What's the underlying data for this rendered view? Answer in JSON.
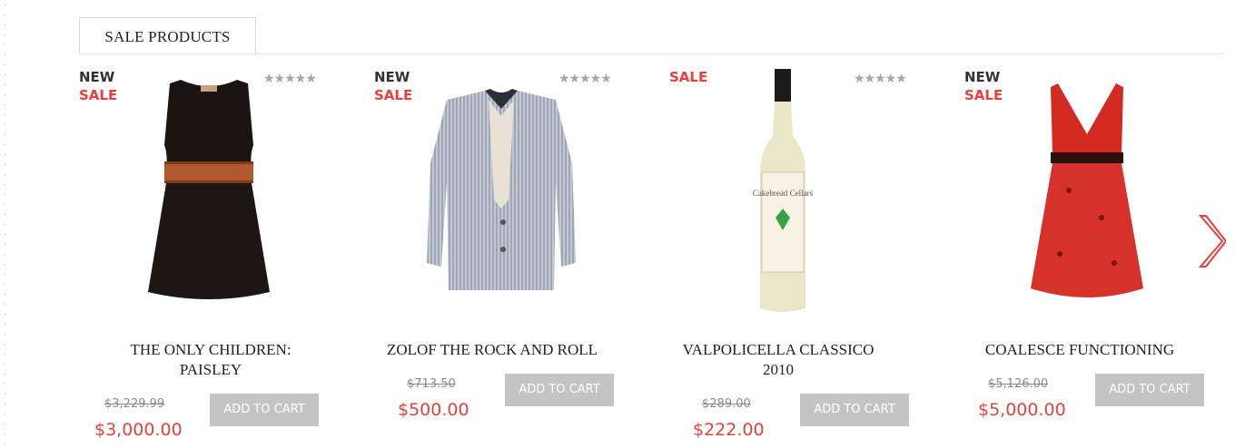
{
  "section": {
    "tab_label": "SALE PRODUCTS"
  },
  "products": [
    {
      "name": "THE ONLY CHILDREN: PAISLEY",
      "badge_new": "NEW",
      "badge_sale": "SALE",
      "old_price": "$3,229.99",
      "price": "$3,000.00",
      "cart_label": "ADD TO CART",
      "stars": "★★★★★",
      "image": "black-dress-image"
    },
    {
      "name": "ZOLOF THE ROCK AND ROLL",
      "badge_new": "NEW",
      "badge_sale": "SALE",
      "old_price": "$713.50",
      "price": "$500.00",
      "cart_label": "ADD TO CART",
      "stars": "★★★★★",
      "image": "striped-blazer-image"
    },
    {
      "name": "VALPOLICELLA CLASSICO 2010",
      "badge_sale": "SALE",
      "old_price": "$289.00",
      "price": "$222.00",
      "cart_label": "ADD TO CART",
      "stars": "★★★★★",
      "image": "wine-bottle-image",
      "bottle_label": "Cakebread Cellars"
    },
    {
      "name": "COALESCE FUNCTIONING",
      "badge_new": "NEW",
      "badge_sale": "SALE",
      "old_price": "$5,126.00",
      "price": "$5,000.00",
      "cart_label": "ADD TO CART",
      "stars": "★★★★★",
      "image": "red-dress-image"
    }
  ],
  "carousel": {
    "next_icon": "chevron-right-icon",
    "accent": "#e8403d"
  },
  "colors": {
    "sale": "#e8403d",
    "button": "#c4c4c4",
    "text": "#222222"
  }
}
